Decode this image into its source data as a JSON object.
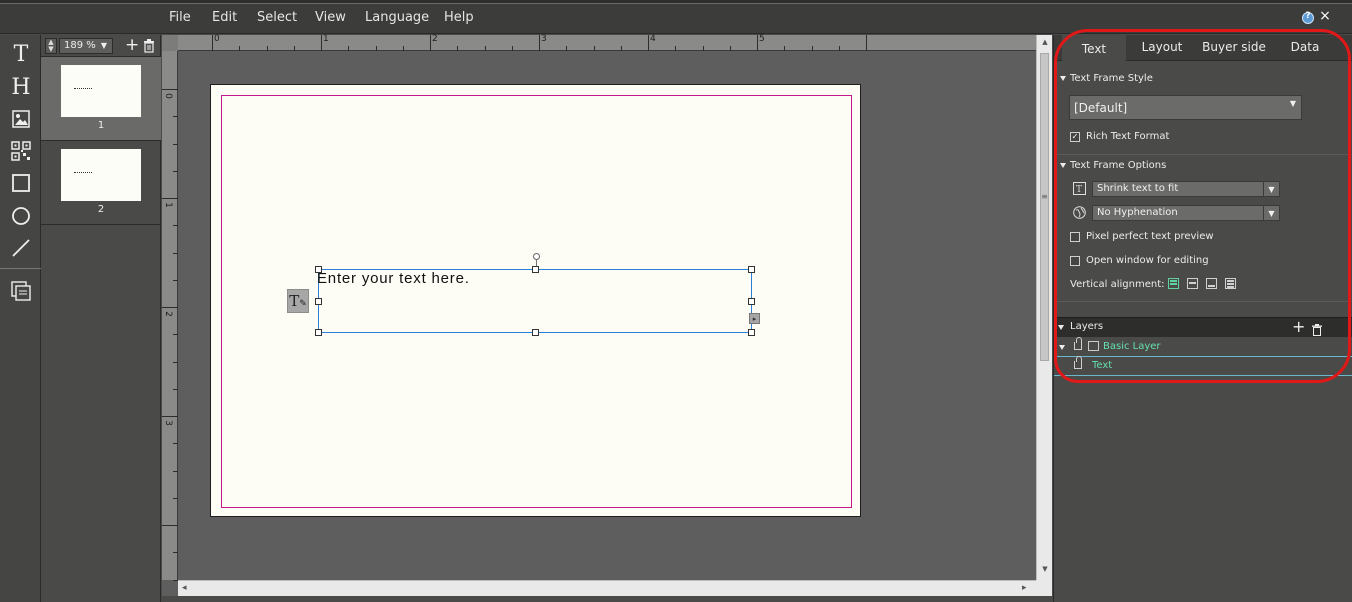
{
  "menubar": {
    "items": [
      "File",
      "Edit",
      "Select",
      "View",
      "Language",
      "Help"
    ],
    "close": "×"
  },
  "pages": {
    "zoom": "189 %",
    "add_glyph": "+",
    "items": [
      {
        "number": "1"
      },
      {
        "number": "2"
      }
    ]
  },
  "ruler": {
    "h_labels": [
      "0",
      "1",
      "2",
      "3",
      "4",
      "5"
    ],
    "v_labels": [
      "0",
      "1",
      "2",
      "3"
    ]
  },
  "canvas": {
    "frame_text": "Enter your text here."
  },
  "panel": {
    "tabs": [
      "Text",
      "Layout",
      "Buyer side",
      "Data"
    ],
    "active_tab": "Text",
    "text_frame_style": {
      "title": "Text Frame Style",
      "selected": "[Default]",
      "rich_text_label": "Rich Text Format",
      "rich_text_checked": true
    },
    "text_frame_options": {
      "title": "Text Frame Options",
      "fit_select": "Shrink text to fit",
      "hyphenation_select": "No Hyphenation",
      "pixel_perfect_label": "Pixel perfect text preview",
      "pixel_perfect_checked": false,
      "open_window_label": "Open window for editing",
      "open_window_checked": false,
      "vertical_alignment_label": "Vertical alignment:"
    },
    "layers": {
      "title": "Layers",
      "add_glyph": "+",
      "items": [
        {
          "label": "Basic Layer"
        },
        {
          "label": "Text"
        }
      ]
    }
  },
  "colors": {
    "accent_green": "#66e0b0",
    "margin_guide": "#c21a8c",
    "frame_border": "#2a7fd8",
    "highlight": "#e01818"
  }
}
